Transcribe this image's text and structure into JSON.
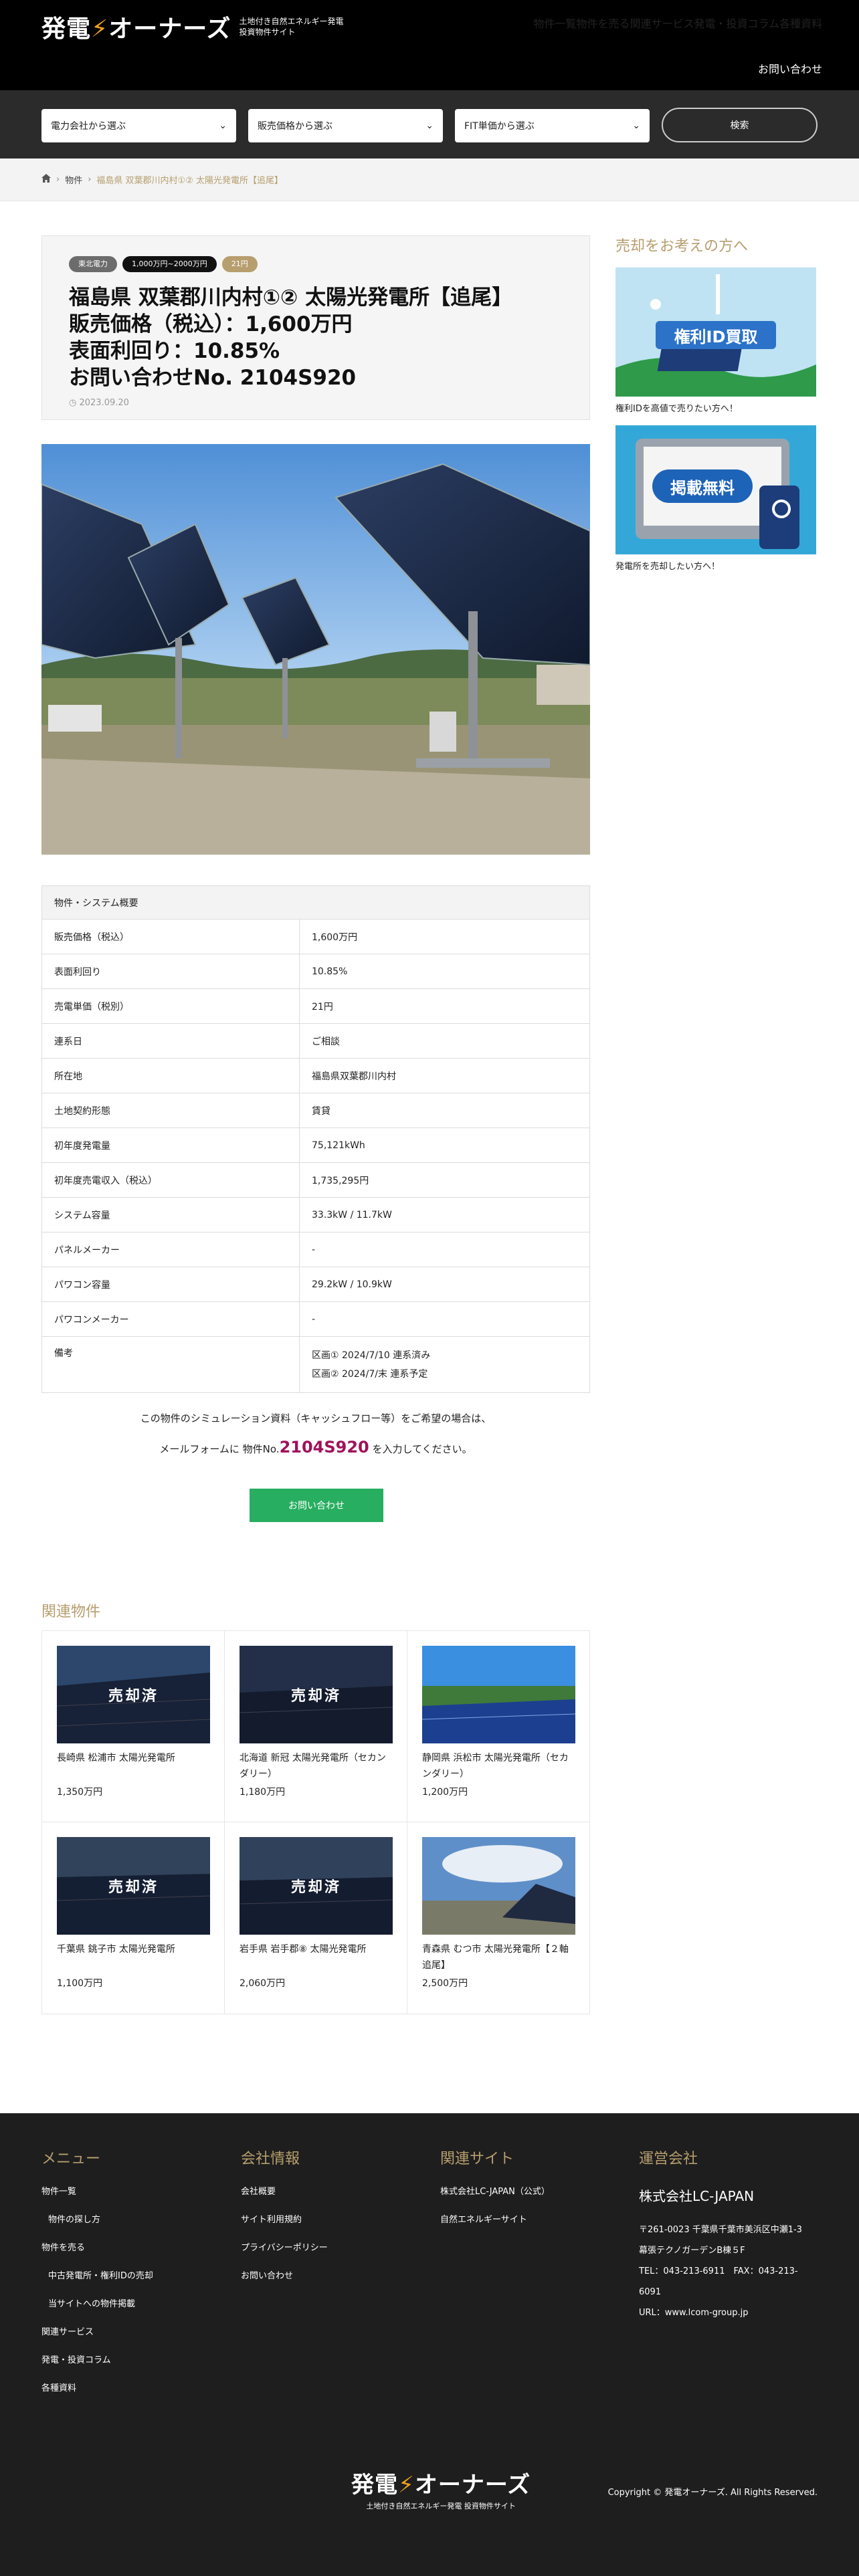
{
  "header": {
    "logo_text_a": "発電",
    "logo_text_b": "オーナーズ",
    "logo_sub_1": "土地付き自然エネルギー発電",
    "logo_sub_2": "投資物件サイト",
    "nav": [
      "物件一覧",
      "物件を売る",
      "関連サービス",
      "発電・投資コラム",
      "各種資料"
    ],
    "contact": "お問い合わせ"
  },
  "search": {
    "select1": "電力会社から選ぶ",
    "select2": "販売価格から選ぶ",
    "select3": "FIT単価から選ぶ",
    "button": "検索"
  },
  "breadcrumb": {
    "items": [
      "物件",
      "福島県 双葉郡川内村①② 太陽光発電所【追尾】"
    ]
  },
  "post": {
    "tags": [
      "東北電力",
      "1,000万円~2000万円",
      "21円"
    ],
    "title_lines": [
      "福島県 双葉郡川内村①② 太陽光発電所【追尾】",
      "販売価格（税込）：1,600万円",
      "表面利回り：10.85%",
      "お問い合わせNo. 2104S920"
    ],
    "date": "2023.09.20"
  },
  "spec": {
    "header": "物件・システム概要",
    "rows": [
      {
        "k": "販売価格（税込）",
        "v": "1,600万円"
      },
      {
        "k": "表面利回り",
        "v": "10.85%"
      },
      {
        "k": "売電単価（税別）",
        "v": "21円"
      },
      {
        "k": "連系日",
        "v": "ご相談"
      },
      {
        "k": "所在地",
        "v": "福島県双葉郡川内村"
      },
      {
        "k": "土地契約形態",
        "v": "賃貸"
      },
      {
        "k": "初年度発電量",
        "v": "75,121kWh"
      },
      {
        "k": "初年度売電収入（税込）",
        "v": "1,735,295円"
      },
      {
        "k": "システム容量",
        "v": "33.3kW / 11.7kW"
      },
      {
        "k": "パネルメーカー",
        "v": "-"
      },
      {
        "k": "パワコン容量",
        "v": "29.2kW / 10.9kW"
      },
      {
        "k": "パワコンメーカー",
        "v": "-"
      }
    ],
    "note_key": "備考",
    "note_lines": [
      "区画① 2024/7/10 連系済み",
      "区画② 2024/7/末 連系予定"
    ]
  },
  "cta": {
    "line1": "この物件のシミュレーション資料（キャッシュフロー等）をご希望の場合は、",
    "line2_pre": "メールフォームに 物件No.",
    "property_no": "2104S920",
    "line2_post": " を入力してください。",
    "button": "お問い合わせ"
  },
  "related": {
    "heading": "関連物件",
    "sold_label": "売却済",
    "items": [
      {
        "name": "長崎県 松浦市 太陽光発電所",
        "price": "1,350万円",
        "sold": true
      },
      {
        "name": "北海道 新冠 太陽光発電所（セカンダリー）",
        "price": "1,180万円",
        "sold": true
      },
      {
        "name": "静岡県 浜松市 太陽光発電所（セカンダリー）",
        "price": "1,200万円",
        "sold": false
      },
      {
        "name": "千葉県 銚子市 太陽光発電所",
        "price": "1,100万円",
        "sold": true
      },
      {
        "name": "岩手県 岩手郡⑧ 太陽光発電所",
        "price": "2,060万円",
        "sold": true
      },
      {
        "name": "青森県 むつ市 太陽光発電所【２軸追尾】",
        "price": "2,500万円",
        "sold": false
      }
    ]
  },
  "sidebar": {
    "heading": "売却をお考えの方へ",
    "banner1_text": "権利ID買取",
    "banner1_caption": "権利IDを高値で売りたい方へ！",
    "banner2_text": "掲載無料",
    "banner2_caption": "発電所を売却したい方へ！"
  },
  "footer": {
    "menu_heading": "メニュー",
    "menu_items": [
      "物件一覧",
      "物件の探し方",
      "物件を売る",
      "中古発電所・権利IDの売却",
      "当サイトへの物件掲載",
      "関連サービス",
      "発電・投資コラム",
      "各種資料"
    ],
    "company_heading": "会社情報",
    "company_items": [
      "会社概要",
      "サイト利用規約",
      "プライバシーポリシー",
      "お問い合わせ"
    ],
    "related_heading": "関連サイト",
    "related_items": [
      "株式会社LC-JAPAN（公式）",
      "自然エネルギーサイト"
    ],
    "operator_heading": "運営会社",
    "operator_name": "株式会社LC-JAPAN",
    "address_1": "〒261-0023 千葉県千葉市美浜区中瀬1-3",
    "address_2": "幕張テクノガーデンB棟５F",
    "tel_fax_1": "TEL：043-213-6911　FAX：043-213-",
    "tel_fax_2": "6091",
    "url": "URL：www.lcom-group.jp",
    "copyright": "Copyright © 発電オーナーズ. All Rights Reserved."
  },
  "colors": {
    "accent": "#b69e6e",
    "button_green": "#27ae60",
    "property_no": "#a0115a"
  }
}
